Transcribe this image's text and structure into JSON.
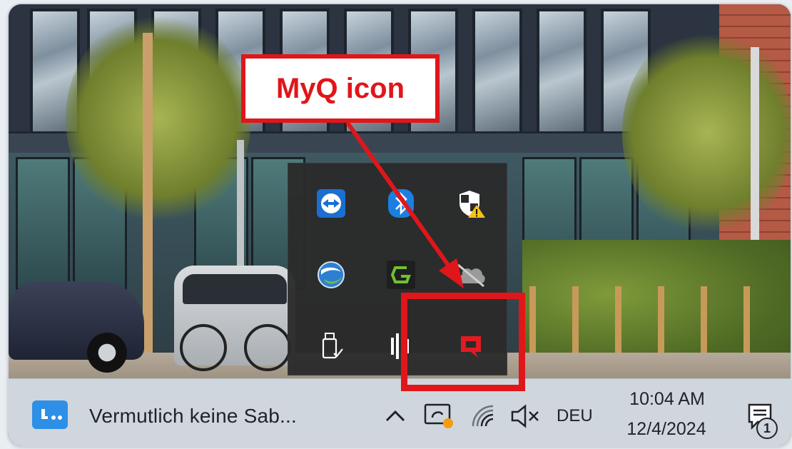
{
  "annotation": {
    "callout_label": "MyQ icon",
    "color": "#e0161a"
  },
  "tray_overflow": {
    "icons": [
      {
        "name": "teamviewer-icon"
      },
      {
        "name": "bluetooth-icon"
      },
      {
        "name": "windows-security-warning-icon"
      },
      {
        "name": "globe-sync-icon"
      },
      {
        "name": "greenshot-icon"
      },
      {
        "name": "onedrive-cloud-paused-icon"
      },
      {
        "name": "usb-safely-remove-icon"
      },
      {
        "name": "audio-bars-icon"
      },
      {
        "name": "myq-icon",
        "highlighted": true
      }
    ]
  },
  "taskbar": {
    "active_app_title": "Vermutlich keine Sab...",
    "system_tray": {
      "chevron": "^",
      "language": "DEU",
      "time": "10:04 AM",
      "date": "12/4/2024",
      "notification_count": "1"
    }
  }
}
